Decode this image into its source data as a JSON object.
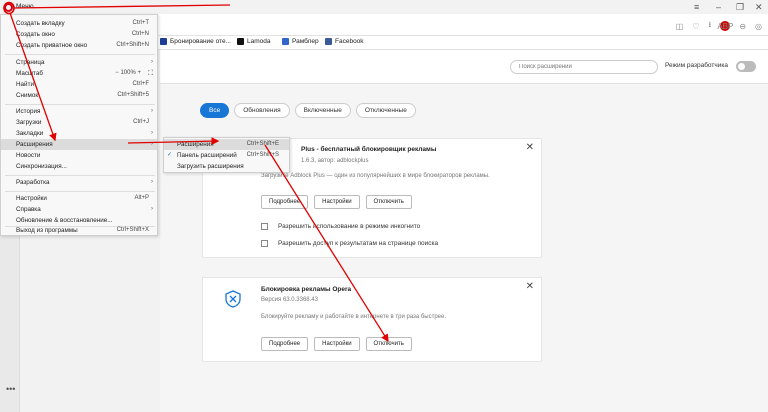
{
  "app": {
    "menu_button_label": "Меню"
  },
  "colors": {
    "accent": "#1876d6",
    "annotation_red": "#e00000",
    "opera_red": "#d0021b"
  },
  "bookmarks": [
    {
      "label": "Бронирование оте...",
      "icon": "booking-icon",
      "color": "#1c3f94"
    },
    {
      "label": "Lamoda",
      "icon": "lamoda-icon",
      "color": "#111111"
    },
    {
      "label": "Рамблер",
      "icon": "rambler-icon",
      "color": "#3366cc"
    },
    {
      "label": "Facebook",
      "icon": "facebook-icon",
      "color": "#3b5998"
    }
  ],
  "menu": {
    "items": [
      {
        "label": "Создать вкладку",
        "shortcut": "Ctrl+T"
      },
      {
        "label": "Создать окно",
        "shortcut": "Ctrl+N"
      },
      {
        "label": "Создать приватное окно",
        "shortcut": "Ctrl+Shift+N"
      },
      {
        "label": "Страница",
        "shortcut": ""
      },
      {
        "label": "Масштаб",
        "shortcut": ""
      },
      {
        "label": "Найти",
        "shortcut": "Ctrl+F"
      },
      {
        "label": "Снимок",
        "shortcut": "Ctrl+Shift+5"
      },
      {
        "label": "История",
        "shortcut": ""
      },
      {
        "label": "Загрузки",
        "shortcut": "Ctrl+J"
      },
      {
        "label": "Закладки",
        "shortcut": ""
      },
      {
        "label": "Расширения",
        "shortcut": ""
      },
      {
        "label": "Новости",
        "shortcut": ""
      },
      {
        "label": "Синхронизация...",
        "shortcut": ""
      },
      {
        "label": "Разработка",
        "shortcut": ""
      },
      {
        "label": "Настройки",
        "shortcut": "Alt+P"
      },
      {
        "label": "Справка",
        "shortcut": ""
      },
      {
        "label": "Обновление & восстановление...",
        "shortcut": ""
      },
      {
        "label": "Выход из программы",
        "shortcut": "Ctrl+Shift+X"
      }
    ],
    "zoom": {
      "minus": "−",
      "value": "100%",
      "plus": "+"
    }
  },
  "submenu": {
    "items": [
      {
        "label": "Расширения",
        "shortcut": "Ctrl+Shift+E"
      },
      {
        "label": "Панель расширений",
        "shortcut": "Ctrl+Shift+S"
      },
      {
        "label": "Загрузить расширения",
        "shortcut": ""
      }
    ]
  },
  "extensions_page": {
    "search_placeholder": "Поиск расширений",
    "dev_mode_label": "Режим разработчика",
    "filters": [
      "Все",
      "Обновления",
      "Включенные",
      "Отключенные"
    ]
  },
  "cards": [
    {
      "title": "Plus - бесплатный блокировщик рекламы",
      "version": "1.6.3, автор: adblockplus",
      "description": "Загрузите Adblock Plus — один из популярнейших в мире блокираторов рекламы.",
      "buttons": [
        "Подробнее",
        "Настройки",
        "Отключить"
      ],
      "options": [
        "Разрешить использование в режиме инкогнито",
        "Разрешить доступ к результатам на странице поиска"
      ]
    },
    {
      "title": "Блокировка рекламы Opera",
      "version": "Версия 63.0.3368.43",
      "description": "Блокируйте рекламу и работайте в интернете в три раза быстрее.",
      "buttons": [
        "Подробнее",
        "Настройки",
        "Отключить"
      ]
    }
  ],
  "sidebar": {
    "more_label": "•••"
  }
}
